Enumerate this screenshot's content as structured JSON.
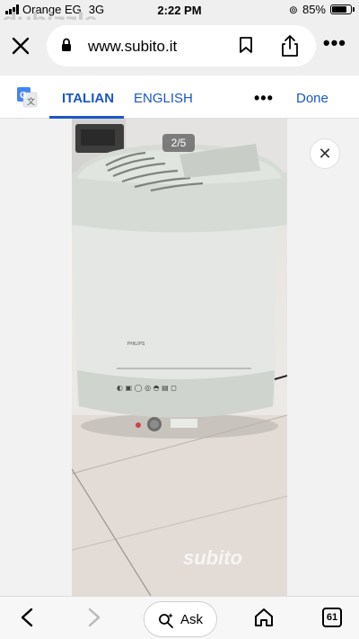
{
  "status_bar": {
    "carrier": "Orange EG",
    "network": "3G",
    "time": "2:22 PM",
    "battery": "85%",
    "battery_level": 0.85,
    "overlay_logo": "dubizzle"
  },
  "browser": {
    "url": "www.subito.it",
    "icons": [
      "close-icon",
      "lock-icon",
      "bookmark-icon",
      "share-icon",
      "more-icon"
    ]
  },
  "translate_bar": {
    "tab_italian": "ITALIAN",
    "tab_english": "ENGLISH",
    "done_label": "Done",
    "active_tab": "ITALIAN",
    "accent_color": "#1a56c8"
  },
  "gallery": {
    "counter": "2/5",
    "watermark": "subito"
  },
  "toolbar": {
    "ask_label": "Ask",
    "tab_count": "61"
  }
}
